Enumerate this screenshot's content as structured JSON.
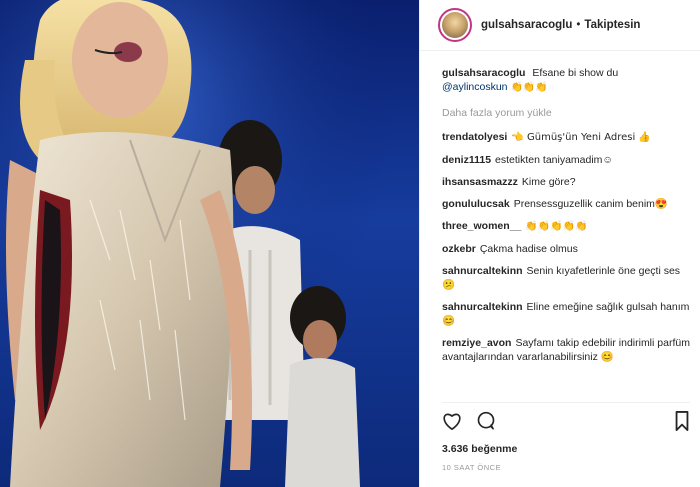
{
  "post": {
    "username": "gulsahsaracoglu",
    "follow_label": "Takiptesin",
    "caption_user": "gulsahsaracoglu",
    "caption_text": "Efsane bi show du",
    "caption_mention": "@aylincoskun",
    "caption_emoji": "👏👏👏",
    "load_more": "Daha fazla yorum yükle"
  },
  "comments": [
    {
      "user": "trendatolyesi",
      "text": "👈 Gümüş'ün Yeni Adresi 👍"
    },
    {
      "user": "deniz1115",
      "text": "estetikten taniyamadim☺"
    },
    {
      "user": "ihsansasmazzz",
      "text": "Kime göre?"
    },
    {
      "user": "gonululucsak",
      "text": "Prensessguzellik canim benim😍"
    },
    {
      "user": "three_women__",
      "text": "👏👏👏👏👏"
    },
    {
      "user": "ozkebr",
      "text": "Çakma hadise olmus"
    },
    {
      "user": "sahnurcaltekinn",
      "text": "Senin kıyafetlerinle öne geçti ses 😕"
    },
    {
      "user": "sahnurcaltekinn",
      "text": "Eline emeğine sağlık gulsah hanım 😊"
    },
    {
      "user": "remziye_avon",
      "text": "Sayfamı takip edebilir indirimli parfüm avantajlarından vararlanabilirsiniz 😊"
    }
  ],
  "stats": {
    "likes": "3.636 beğenme",
    "time": "10 SAAT ÖNCE"
  },
  "icons": {
    "like": "heart-icon",
    "comment": "comment-icon",
    "save": "bookmark-icon"
  },
  "colors": {
    "stage_blue": "#163c9e",
    "text": "#262626",
    "muted": "#999999",
    "mention": "#003569"
  }
}
